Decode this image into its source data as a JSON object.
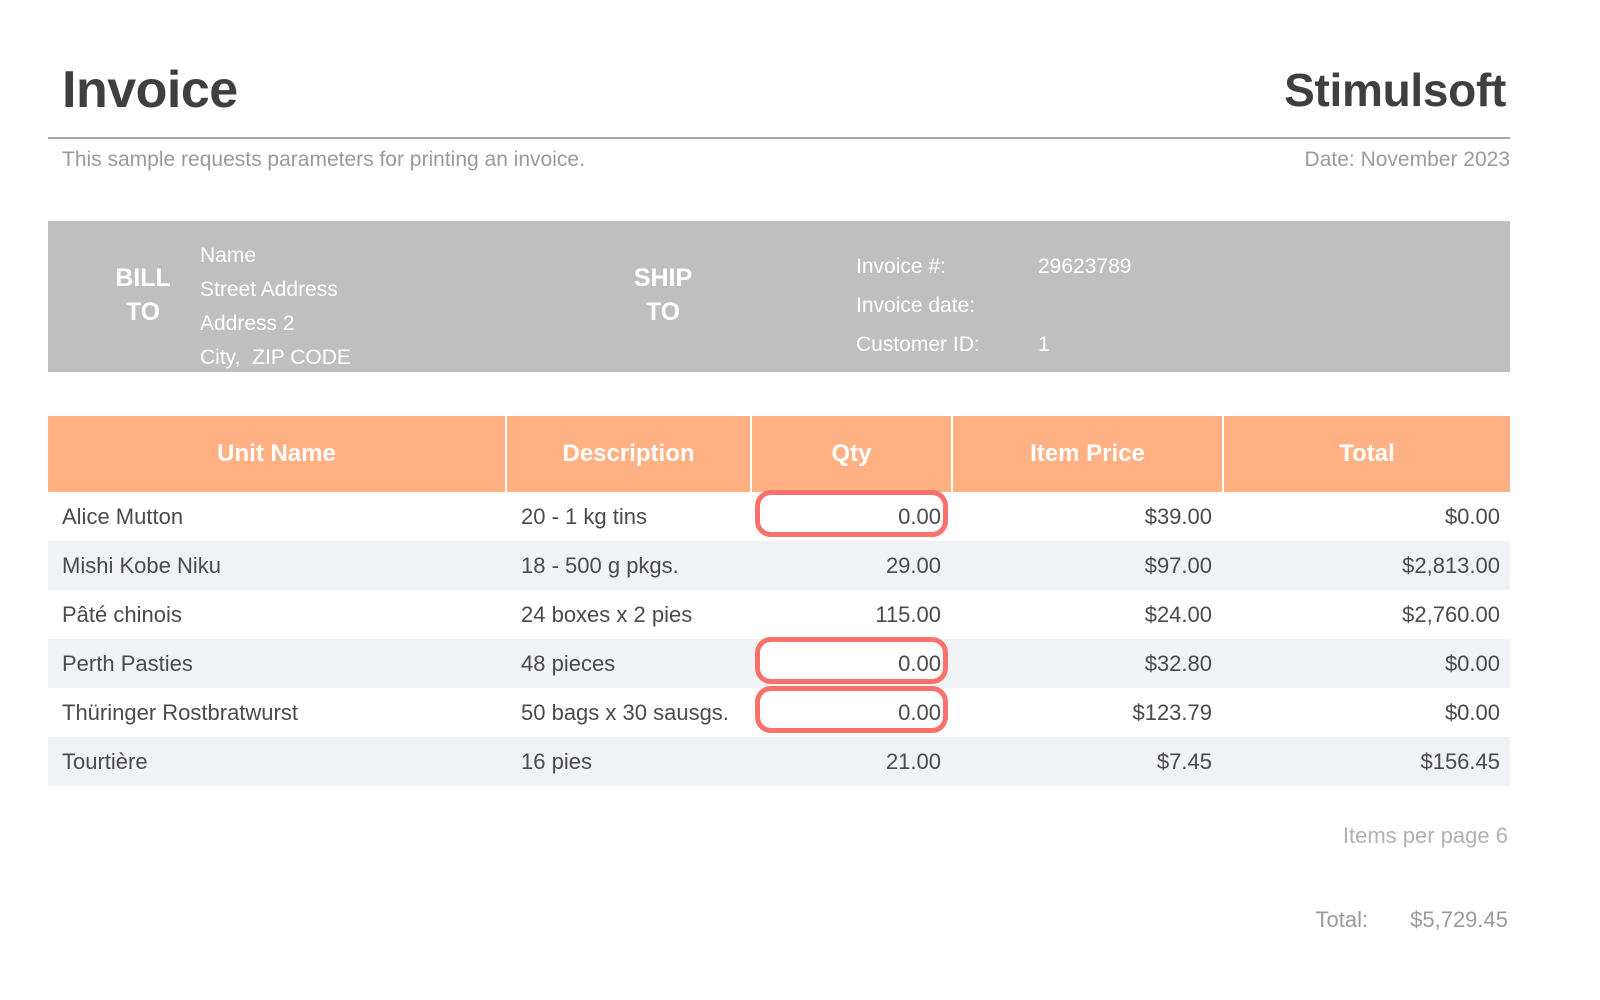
{
  "header": {
    "title": "Invoice",
    "brand": "Stimulsoft",
    "subtitle": "This sample requests parameters for printing an invoice.",
    "date": "Date: November 2023"
  },
  "address_band": {
    "bill_to_label_line1": "BILL",
    "bill_to_label_line2": "TO",
    "ship_to_label_line1": "SHIP",
    "ship_to_label_line2": "TO",
    "address_lines": [
      "Name",
      "Street Address",
      "Address 2",
      "City,  ZIP CODE"
    ],
    "meta": [
      {
        "label": "Invoice #:",
        "value": "29623789"
      },
      {
        "label": "Invoice date:",
        "value": ""
      },
      {
        "label": "Customer ID:",
        "value": "1"
      }
    ]
  },
  "table": {
    "columns": [
      "Unit Name",
      "Description",
      "Qty",
      "Item Price",
      "Total"
    ],
    "rows": [
      {
        "unit_name": "Alice Mutton",
        "description": "20 - 1 kg tins",
        "qty": "0.00",
        "item_price": "$39.00",
        "total": "$0.00",
        "qty_highlighted": true
      },
      {
        "unit_name": "Mishi Kobe Niku",
        "description": "18 - 500 g pkgs.",
        "qty": "29.00",
        "item_price": "$97.00",
        "total": "$2,813.00",
        "qty_highlighted": false
      },
      {
        "unit_name": "Pâté chinois",
        "description": "24 boxes x 2 pies",
        "qty": "115.00",
        "item_price": "$24.00",
        "total": "$2,760.00",
        "qty_highlighted": false
      },
      {
        "unit_name": "Perth Pasties",
        "description": "48 pieces",
        "qty": "0.00",
        "item_price": "$32.80",
        "total": "$0.00",
        "qty_highlighted": true
      },
      {
        "unit_name": "Thüringer Rostbratwurst",
        "description": "50 bags x 30 sausgs.",
        "qty": "0.00",
        "item_price": "$123.79",
        "total": "$0.00",
        "qty_highlighted": true
      },
      {
        "unit_name": "Tourtière",
        "description": "16 pies",
        "qty": "21.00",
        "item_price": "$7.45",
        "total": "$156.45",
        "qty_highlighted": false
      }
    ]
  },
  "footer": {
    "items_per_page": "Items per page 6",
    "total_label": "Total:",
    "total_value": "$5,729.45"
  },
  "colors": {
    "header_orange": "#ffb184",
    "band_gray": "#bfbfbf",
    "stripe_gray": "#f1f2f6",
    "highlight_red": "#fa706b",
    "muted_text": "#9a9a9a",
    "title_text": "#3f3f3f"
  }
}
